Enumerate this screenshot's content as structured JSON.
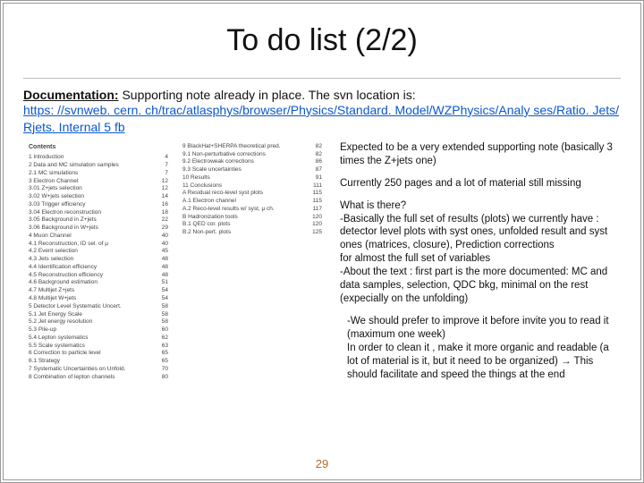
{
  "title": "To do list (2/2)",
  "doc_label": "Documentation:",
  "doc_text": " Supporting note already in place. The svn location is:",
  "link_text": "https: //svnweb. cern. ch/trac/atlasphys/browser/Physics/Standard. Model/WZPhysics/Analy ses/Ratio. Jets/Rjets. Internal 5 fb",
  "link_href": "https://svnweb.cern.ch/trac/atlasphys/browser/Physics/StandardModel/WZPhysics/Analyses/RatioJets/RjetsInternal5fb",
  "right": {
    "p1": "Expected to be a very extended supporting note (basically 3 times the Z+jets one)",
    "p2": "Currently 250 pages and a lot of material still missing",
    "p3": "What is there?\n-Basically the full set of results (plots) we currently have : detector level plots with syst ones, unfolded result and syst ones (matrices, closure), Prediction corrections\nfor almost the full set of variables\n-About the text : first part is the more documented: MC and data samples, selection, QDC bkg, minimal on the rest (expecially on the unfolding)",
    "p4": "-We should prefer to  improve it before invite you to read it (maximum one week)\nIn order to clean it , make it more organic and readable (a lot of material is it, but it need to be organized) → This should facilitate and speed the things at the end"
  },
  "toc_left_head": "Contents",
  "toc_left": [
    {
      "l": "1  Introduction",
      "p": "4"
    },
    {
      "l": "2  Data and MC simulation samples",
      "p": "7"
    },
    {
      "l": "   2.1  MC simulations",
      "p": "7"
    },
    {
      "l": "3  Electron Channel",
      "p": "12"
    },
    {
      "l": "   3.01  Z+jets selection",
      "p": "12"
    },
    {
      "l": "   3.02  W+jets selection",
      "p": "14"
    },
    {
      "l": "   3.03  Trigger efficiency",
      "p": "16"
    },
    {
      "l": "   3.04  Electron reconstruction",
      "p": "18"
    },
    {
      "l": "   3.05  Background in Z+jets",
      "p": "22"
    },
    {
      "l": "   3.06  Background in W+jets",
      "p": "29"
    },
    {
      "l": "4  Muon Channel",
      "p": "40"
    },
    {
      "l": "   4.1  Reconstruction, ID sel. of μ",
      "p": "40"
    },
    {
      "l": "   4.2  Event selection",
      "p": "45"
    },
    {
      "l": "   4.3  Jets selection",
      "p": "48"
    },
    {
      "l": "   4.4  Identification efficiency",
      "p": "48"
    },
    {
      "l": "   4.5  Reconstruction efficiency",
      "p": "48"
    },
    {
      "l": "   4.6  Background estimation",
      "p": "51"
    },
    {
      "l": "   4.7  Multijet Z+jets",
      "p": "54"
    },
    {
      "l": "   4.8  Multijet W+jets",
      "p": "54"
    },
    {
      "l": "5  Detector Level Systematic Uncert.",
      "p": "58"
    },
    {
      "l": "   5.1  Jet Energy Scale",
      "p": "58"
    },
    {
      "l": "   5.2  Jet energy resolution",
      "p": "58"
    },
    {
      "l": "   5.3  Pile-up",
      "p": "60"
    },
    {
      "l": "   5.4  Lepton systematics",
      "p": "62"
    },
    {
      "l": "   5.5  Scale systematics",
      "p": "63"
    },
    {
      "l": "6  Correction to particle level",
      "p": "65"
    },
    {
      "l": "   6.1  Strategy",
      "p": "65"
    },
    {
      "l": "7  Systematic Uncertainties on Unfold.",
      "p": "70"
    },
    {
      "l": "8  Combination of lepton channels",
      "p": "80"
    }
  ],
  "toc_right": [
    {
      "l": "9  BlackHat+SHERPA theoretical pred.",
      "p": "82"
    },
    {
      "l": "   9.1  Non-perturbative corrections",
      "p": "82"
    },
    {
      "l": "   9.2  Electroweak corrections",
      "p": "86"
    },
    {
      "l": "   9.3  Scale uncertainties",
      "p": "87"
    },
    {
      "l": "10  Results",
      "p": "91"
    },
    {
      "l": "11  Conclusions",
      "p": "111"
    },
    {
      "l": "A  Residual reco-level syst plots",
      "p": "115"
    },
    {
      "l": "   A.1  Electron channel",
      "p": "115"
    },
    {
      "l": "   A.2  Reco-level results w/ syst, μ ch.",
      "p": "117"
    },
    {
      "l": "B  Hadronization tools",
      "p": "120"
    },
    {
      "l": "   B.1  QED cor. plots",
      "p": "120"
    },
    {
      "l": "   B.2  Non-pert. plots",
      "p": "125"
    }
  ],
  "page_number": "29"
}
